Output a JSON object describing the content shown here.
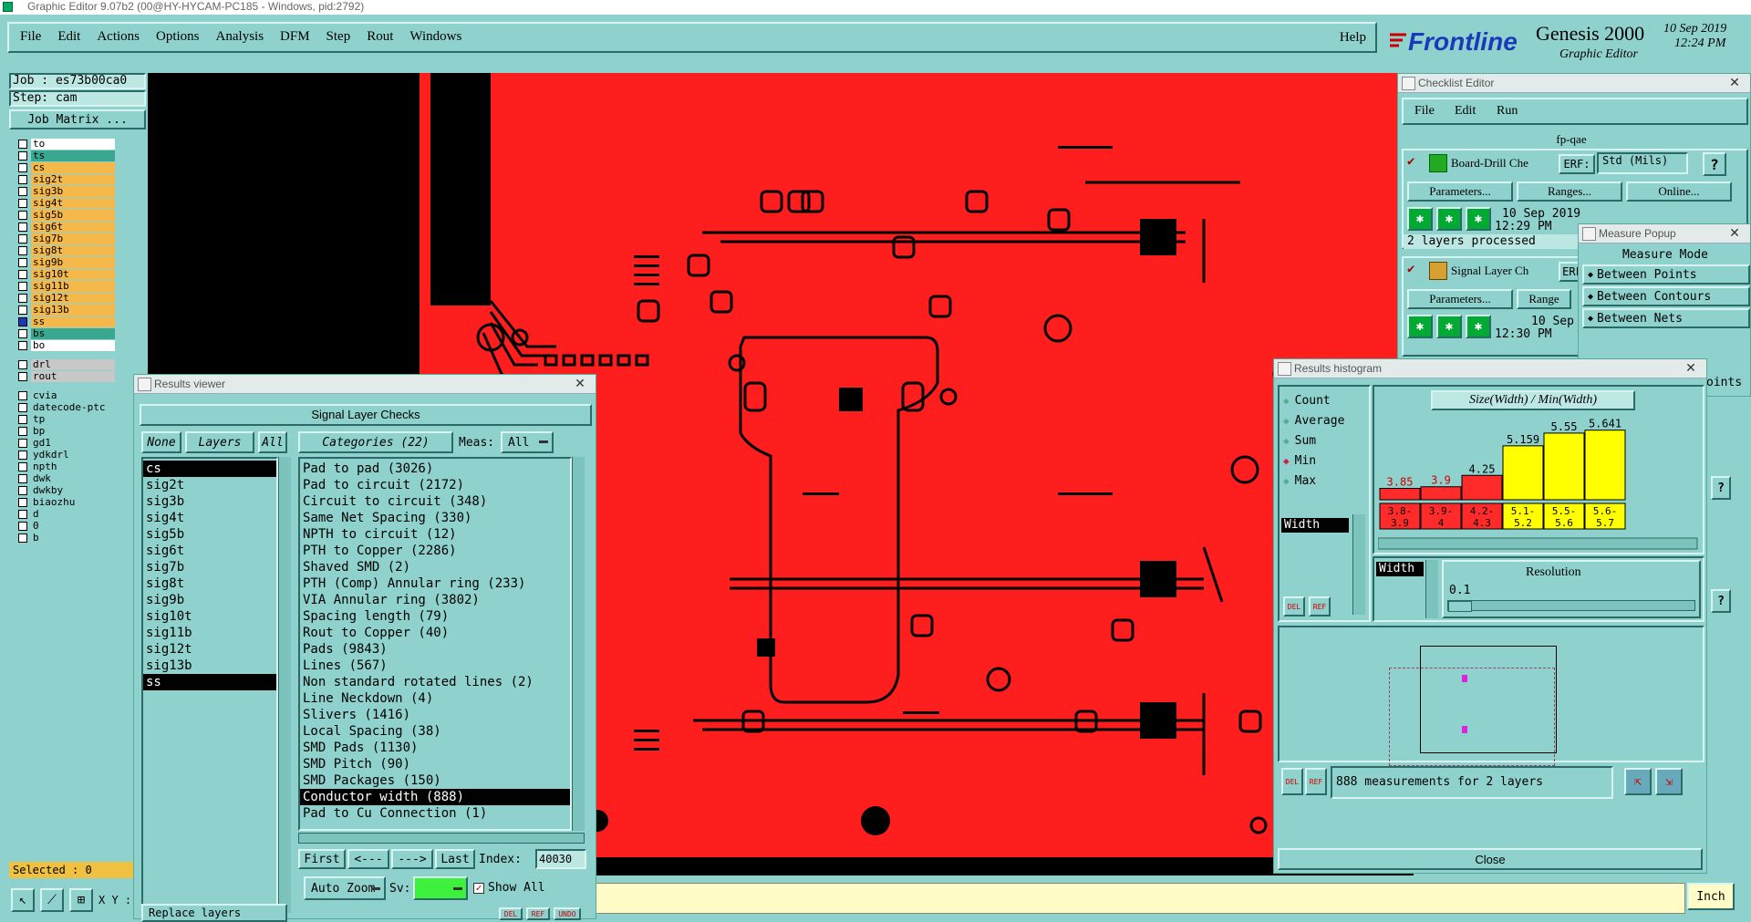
{
  "window_title": "Graphic Editor 9.07b2 (00@HY-HYCAM-PC185 - Windows, pid:2792)",
  "menu": [
    "File",
    "Edit",
    "Actions",
    "Options",
    "Analysis",
    "DFM",
    "Step",
    "Rout",
    "Windows"
  ],
  "help": "Help",
  "brand": {
    "logo": "Frontline",
    "product": "Genesis 2000",
    "subtitle": "Graphic Editor",
    "date": "10 Sep 2019",
    "time": "12:24 PM",
    "accent": "#cc0000"
  },
  "job": "Job : es73b00ca0",
  "step": "Step: cam",
  "job_matrix": "Job Matrix ...",
  "layers": [
    {
      "name": "to",
      "color": "#ffffff"
    },
    {
      "name": "ts",
      "color": "#3aa890"
    },
    {
      "name": "cs",
      "color": "#f5b84a"
    },
    {
      "name": "sig2t",
      "color": "#f5b84a"
    },
    {
      "name": "sig3b",
      "color": "#f5b84a"
    },
    {
      "name": "sig4t",
      "color": "#f5b84a"
    },
    {
      "name": "sig5b",
      "color": "#f5b84a"
    },
    {
      "name": "sig6t",
      "color": "#f5b84a"
    },
    {
      "name": "sig7b",
      "color": "#f5b84a"
    },
    {
      "name": "sig8t",
      "color": "#f5b84a"
    },
    {
      "name": "sig9b",
      "color": "#f5b84a"
    },
    {
      "name": "sig10t",
      "color": "#f5b84a"
    },
    {
      "name": "sig11b",
      "color": "#f5b84a"
    },
    {
      "name": "sig12t",
      "color": "#f5b84a"
    },
    {
      "name": "sig13b",
      "color": "#f5b84a"
    },
    {
      "name": "ss",
      "color": "#f5b84a"
    },
    {
      "name": "bs",
      "color": "#3aa890"
    },
    {
      "name": "bo",
      "color": "#ffffff"
    },
    {
      "name": "drl",
      "color": "#c8c8c8"
    },
    {
      "name": "rout",
      "color": "#c8c8c8"
    },
    {
      "name": "cvia",
      "color": "#8fd1cc"
    },
    {
      "name": "datecode-ptc",
      "color": "#8fd1cc"
    },
    {
      "name": "tp",
      "color": "#8fd1cc"
    },
    {
      "name": "bp",
      "color": "#8fd1cc"
    },
    {
      "name": "gd1",
      "color": "#8fd1cc"
    },
    {
      "name": "ydkdrl",
      "color": "#8fd1cc"
    },
    {
      "name": "npth",
      "color": "#8fd1cc"
    },
    {
      "name": "dwk",
      "color": "#8fd1cc"
    },
    {
      "name": "dwkby",
      "color": "#8fd1cc"
    },
    {
      "name": "biaozhu",
      "color": "#8fd1cc"
    },
    {
      "name": "d",
      "color": "#8fd1cc"
    },
    {
      "name": "0",
      "color": "#8fd1cc"
    },
    {
      "name": "b",
      "color": "#8fd1cc"
    }
  ],
  "selected": "Selected : 0",
  "xy_label": "X Y :",
  "units": "Inch",
  "results_viewer": {
    "title": "Results viewer",
    "header": "Signal Layer Checks",
    "none": "None",
    "layers": "Layers",
    "all": "All",
    "categories": "Categories (22)",
    "meas_label": "Meas:",
    "meas_value": "All",
    "layer_list": [
      "cs",
      "sig2t",
      "sig3b",
      "sig4t",
      "sig5b",
      "sig6t",
      "sig7b",
      "sig8t",
      "sig9b",
      "sig10t",
      "sig11b",
      "sig12t",
      "sig13b",
      "ss"
    ],
    "category_list": [
      "Pad to pad (3026)",
      "Pad to circuit (2172)",
      "Circuit to circuit (348)",
      "Same Net Spacing (330)",
      "NPTH to circuit (12)",
      "PTH to Copper (2286)",
      "Shaved SMD (2)",
      "PTH (Comp) Annular ring (233)",
      "VIA Annular ring (3802)",
      "Spacing length (79)",
      "Rout to Copper (40)",
      "Pads (9843)",
      "Lines (567)",
      "Non standard rotated lines (2)",
      "Line Neckdown (4)",
      "Slivers (1416)",
      "Local Spacing (38)",
      "SMD Pads (1130)",
      "SMD Pitch (90)",
      "SMD Packages (150)",
      "Conductor width (888)",
      "Pad to Cu Connection (1)"
    ],
    "first": "First",
    "prev": "<---",
    "next": "--->",
    "last": "Last",
    "index_label": "Index:",
    "index_value": "40030",
    "auto_zoom": "Auto Zoom",
    "sv": "Sv:",
    "show_all": "Show All",
    "replace_layers": "Replace layers",
    "del": "DEL",
    "ref": "REF",
    "undo": "UNDO"
  },
  "checklist": {
    "title": "Checklist Editor",
    "menu": [
      "File",
      "Edit",
      "Run"
    ],
    "name": "fp-qae",
    "item1": {
      "name": "Board-Drill Che",
      "erf": "ERF:",
      "erf_value": "Std (Mils)",
      "params": "Parameters...",
      "ranges": "Ranges...",
      "online": "Online...",
      "date": "10 Sep 2019",
      "time": "12:29 PM",
      "status": "2 layers processed"
    },
    "item2": {
      "name": "Signal Layer Ch",
      "erf": "ERF",
      "params": "Parameters...",
      "ranges": "Range",
      "date": "10 Sep",
      "time": "12:30 PM"
    }
  },
  "measure": {
    "title": "Measure Popup",
    "mode": "Measure Mode",
    "items": [
      "Between Points",
      "Between Contours",
      "Between Nets"
    ],
    "partial": "oints"
  },
  "histogram": {
    "title": "Results histogram",
    "modes": [
      "Count",
      "Average",
      "Sum",
      "Min",
      "Max"
    ],
    "selected_mode": "Min",
    "field": "Width",
    "chart_title": "Size(Width) / Min(Width)",
    "resolution_label": "Resolution",
    "resolution_value": "0.1",
    "field2": "Width",
    "summary": "888 measurements for 2 layers",
    "close": "Close",
    "del": "DEL",
    "ref": "REF"
  },
  "chart_data": {
    "type": "bar",
    "title": "Size(Width) / Min(Width)",
    "categories": [
      "3.8-3.9",
      "3.9-4",
      "4.2-4.3",
      "5.1-5.2",
      "5.5-5.6",
      "5.6-5.7"
    ],
    "values": [
      3.85,
      3.9,
      4.25,
      5.159,
      5.55,
      5.641
    ],
    "value_labels": [
      "3.85",
      "3.9",
      "4.25",
      "5.159",
      "5.55",
      "5.641"
    ],
    "category_labels_top": [
      "3.8-",
      "3.9-",
      "4.2-",
      "5.1-",
      "5.5-",
      "5.6-"
    ],
    "category_labels_bottom": [
      "3.9",
      "4",
      "4.3",
      "5.2",
      "5.6",
      "5.7"
    ],
    "colors": [
      "#ff2a2a",
      "#ff2a2a",
      "#ff2a2a",
      "#ffff00",
      "#ffff00",
      "#ffff00"
    ],
    "ylim": [
      3.5,
      5.8
    ]
  }
}
